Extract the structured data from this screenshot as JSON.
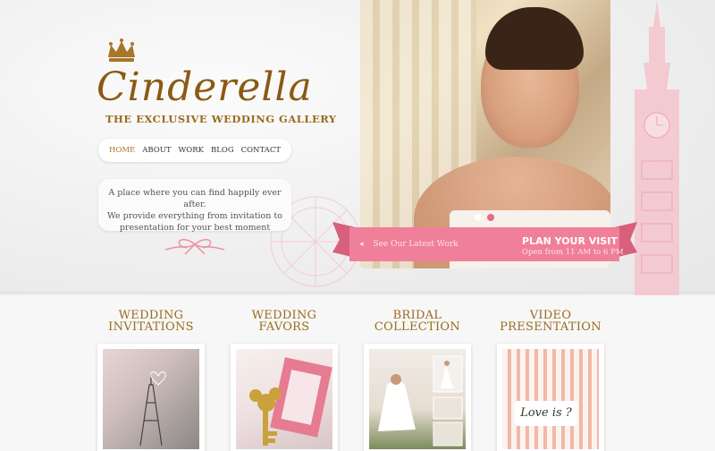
{
  "brand": {
    "name": "Cinderella",
    "subtitle": "THE EXCLUSIVE WEDDING GALLERY",
    "gold": "#9a6b1e",
    "pink": "#f07f9a"
  },
  "nav": {
    "items": [
      {
        "label": "HOME",
        "active": true
      },
      {
        "label": "ABOUT"
      },
      {
        "label": "WORK"
      },
      {
        "label": "BLOG"
      },
      {
        "label": "CONTACT"
      }
    ]
  },
  "tagline": {
    "line1": "A place where you can find happily ever after.",
    "line2": "We provide everything from invitation to",
    "line3": "presentation for your best moment"
  },
  "slider": {
    "dots": 2,
    "active_dot": 1
  },
  "ribbon": {
    "link": "See Our Latest Work",
    "title": "PLAN YOUR VISIT",
    "hours": "Open from 11 AM to 6 PM"
  },
  "categories": [
    {
      "line1": "WEDDING",
      "line2": "INVITATIONS"
    },
    {
      "line1": "WEDDING",
      "line2": "FAVORS"
    },
    {
      "line1": "BRIDAL",
      "line2": "COLLECTION"
    },
    {
      "line1": "VIDEO",
      "line2": "PRESENTATION"
    }
  ],
  "video_card": {
    "caption": "Love is ?"
  },
  "icons": [
    "crown-icon",
    "bow-icon",
    "big-ben-icon",
    "ferris-wheel-icon",
    "arrow-left-icon"
  ]
}
